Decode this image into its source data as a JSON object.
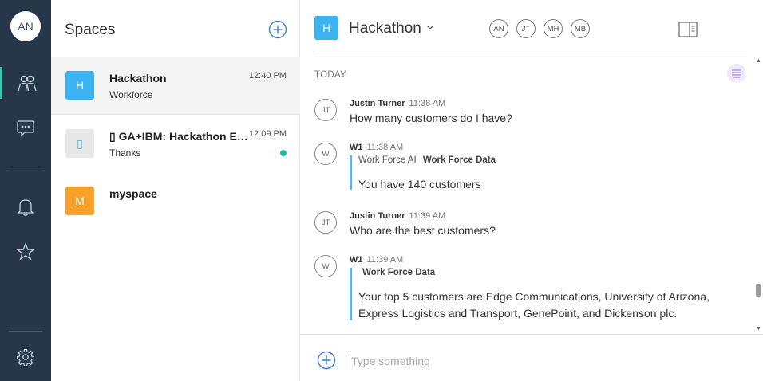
{
  "user": {
    "initials": "AN"
  },
  "rail": {
    "items": [
      {
        "icon": "people-icon",
        "active": true
      },
      {
        "icon": "chat-bubble-icon",
        "active": false
      },
      {
        "icon": "bell-icon",
        "active": false
      },
      {
        "icon": "star-icon",
        "active": false
      },
      {
        "icon": "gear-icon",
        "active": false
      }
    ]
  },
  "spaces": {
    "title": "Spaces",
    "items": [
      {
        "initial": "H",
        "color": "#3ab3f0",
        "name": "Hackathon",
        "subtitle": "Workforce",
        "time": "12:40 PM",
        "selected": true,
        "unread": false
      },
      {
        "initial": "▯",
        "color": "#e8e8e8",
        "name": "▯ GA+IBM: Hackathon Ev…",
        "subtitle": "Thanks",
        "time": "12:09 PM",
        "selected": false,
        "unread": true
      },
      {
        "initial": "M",
        "color": "#f7a02a",
        "name": "myspace",
        "subtitle": "",
        "time": "",
        "selected": false,
        "unread": false
      }
    ]
  },
  "chat": {
    "initial": "H",
    "title": "Hackathon",
    "participants": [
      "AN",
      "JT",
      "MH",
      "MB"
    ],
    "day_label": "TODAY",
    "messages": [
      {
        "avatar": "JT",
        "author": "Justin Turner",
        "time": "11:38 AM",
        "text": "How many customers do I have?"
      },
      {
        "avatar": "W",
        "author": "W1",
        "time": "11:38 AM",
        "card": {
          "app": "Work Force AI",
          "source": "Work Force Data",
          "lines": [
            "You have 140 customers"
          ]
        }
      },
      {
        "avatar": "JT",
        "author": "Justin Turner",
        "time": "11:39 AM",
        "text": "Who are the best customers?"
      },
      {
        "avatar": "W",
        "author": "W1",
        "time": "11:39 AM",
        "card": {
          "app": "",
          "source": "Work Force Data",
          "lines": [
            "Your top 5 customers are Edge Communications, University of Arizona,",
            "Express Logistics and Transport, GenePoint, and Dickenson plc."
          ]
        }
      }
    ],
    "composer": {
      "placeholder": "Type something",
      "value": ""
    }
  },
  "colors": {
    "rail_bg": "#27374a",
    "accent_teal": "#3ec4b0",
    "accent_blue": "#3ab3f0",
    "unread_dot": "#1abc9c"
  }
}
